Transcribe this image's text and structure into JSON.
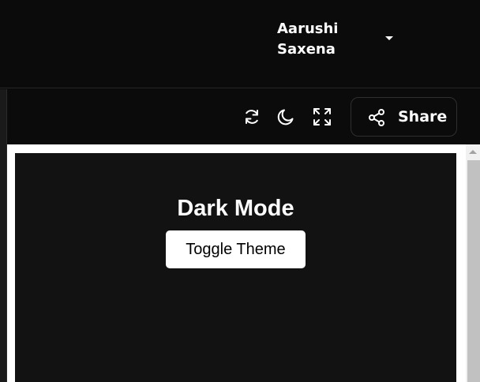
{
  "header": {
    "user_name": "Aarushi\nSaxena"
  },
  "toolbar": {
    "icons": [
      "refresh-icon",
      "moon-icon",
      "expand-icon"
    ],
    "share_label": "Share"
  },
  "preview": {
    "title": "Dark Mode",
    "toggle_button_label": "Toggle Theme"
  },
  "colors": {
    "app_background": "#0b0b0b",
    "preview_background": "#121212",
    "button_background": "#ffffff"
  }
}
